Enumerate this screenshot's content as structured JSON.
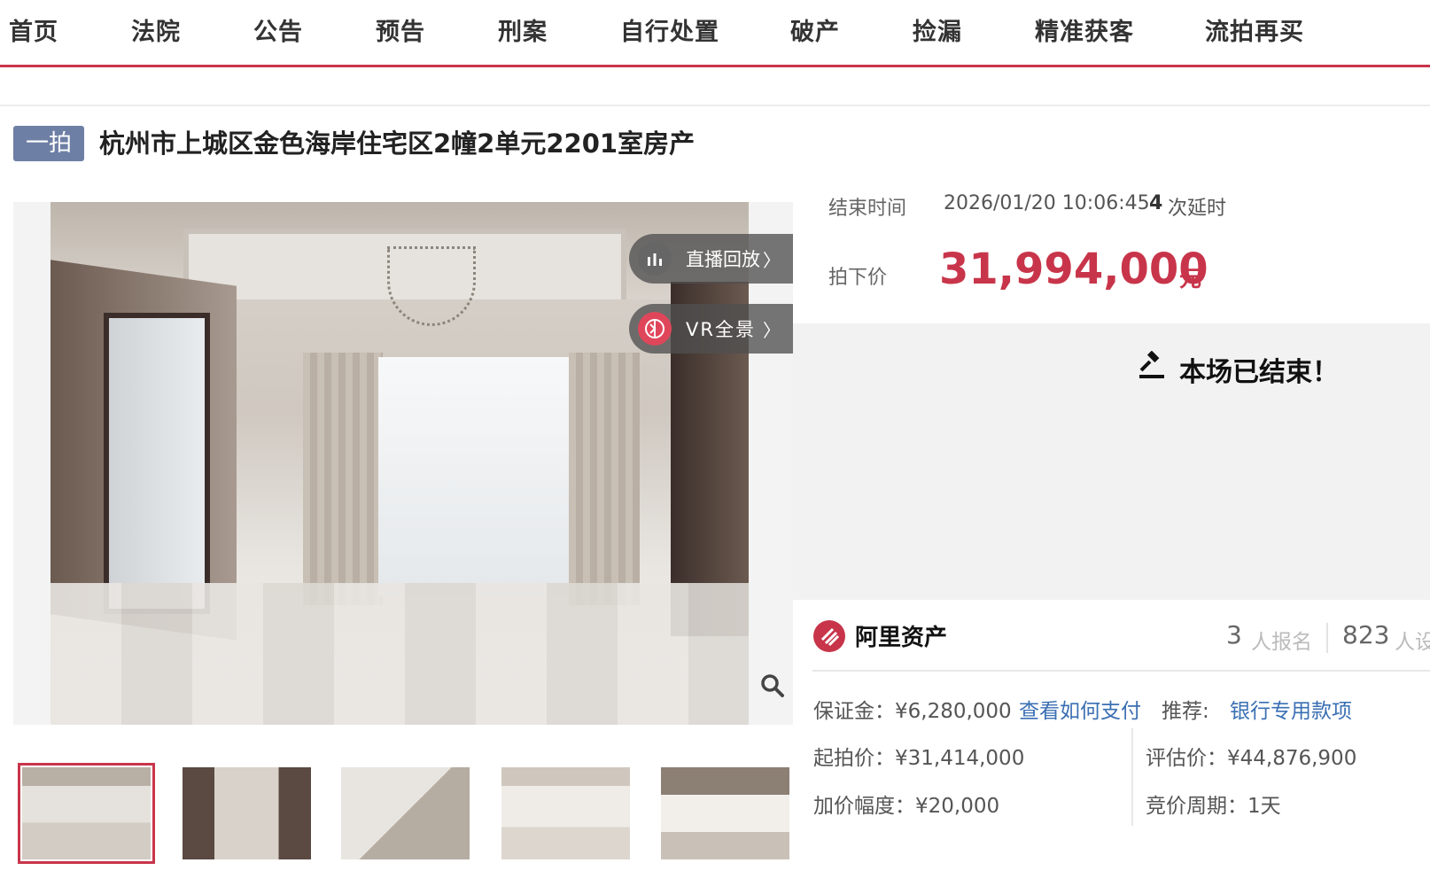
{
  "nav": {
    "items": [
      "首页",
      "法院",
      "公告",
      "预告",
      "刑案",
      "自行处置",
      "破产",
      "捡漏",
      "精准获客",
      "流拍再买"
    ]
  },
  "listing": {
    "tag": "一拍",
    "title": "杭州市上城区金色海岸住宅区2幢2单元2201室房产"
  },
  "media": {
    "live_replay_label": "直播回放",
    "vr_label": "VR全景",
    "thumbnail_count": 5,
    "active_thumbnail": 1,
    "icons": {
      "live": "bar-chart-icon",
      "vr": "vr-panorama-icon",
      "zoom": "magnifier-icon",
      "chevron": "chevron-right-icon"
    }
  },
  "auction": {
    "end_label": "结束时间",
    "end_time": "2026/01/20 10:06:45",
    "delay_count": "4",
    "delay_text": "次延时",
    "price_label": "拍下价",
    "price": "31,994,000",
    "price_unit": "元",
    "status": "本场已结束！",
    "status_icon": "auction-hammer-icon"
  },
  "platform": {
    "name": "阿里资产",
    "logo_icon": "ali-assets-logo-icon",
    "signup_count": "3",
    "signup_text": "人报名",
    "view_count": "823",
    "view_text": "人设"
  },
  "details": {
    "deposit": "保证金：¥6,280,000",
    "pay_link": "查看如何支付",
    "recommend_label": "推荐:",
    "recommend_link": "银行专用款项",
    "start_price": "起拍价：¥31,414,000",
    "valuation": "评估价：¥44,876,900",
    "increment": "加价幅度：¥20,000",
    "period": "竞价周期：1天"
  },
  "colors": {
    "accent": "#c8354a",
    "tag_bg": "#6e7fa5",
    "link": "#3a6fb3"
  }
}
